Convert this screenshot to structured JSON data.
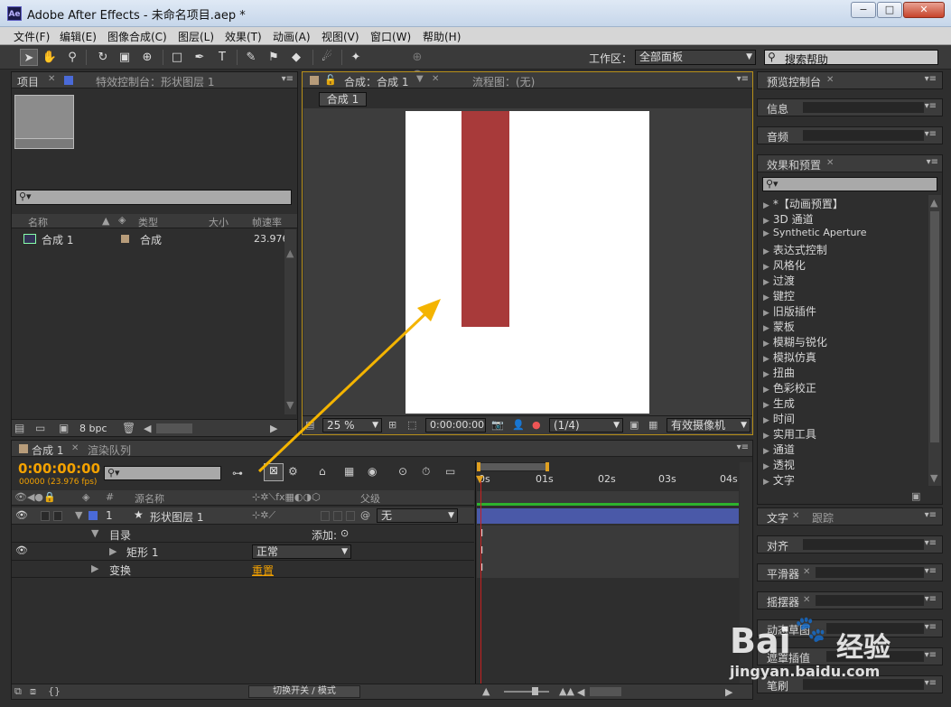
{
  "window": {
    "app_icon": "Ae",
    "title": "Adobe After Effects - 未命名项目.aep *",
    "minimize": "−",
    "maximize": "□",
    "close": "✕"
  },
  "menu": [
    "文件(F)",
    "编辑(E)",
    "图像合成(C)",
    "图层(L)",
    "效果(T)",
    "动画(A)",
    "视图(V)",
    "窗口(W)",
    "帮助(H)"
  ],
  "toolbar": {
    "workspace_label": "工作区：",
    "workspace_value": "全部面板",
    "help_search_placeholder": "搜索帮助"
  },
  "project_panel": {
    "tab": "项目",
    "effects_tab": "特效控制台：形状图层 1",
    "columns": {
      "name": "名称",
      "type": "类型",
      "size": "大小",
      "fps": "帧速率"
    },
    "items": [
      {
        "name": "合成 1",
        "type": "合成",
        "fps": "23.976"
      }
    ],
    "bpc": "8 bpc"
  },
  "comp_panel": {
    "tab": "合成：合成 1",
    "flowchart_tab": "流程图：(无)",
    "subtab": "合成 1",
    "zoom": "25 %",
    "timecode": "0:00:00:00",
    "resolution": "(1/4)",
    "camera": "有效摄像机",
    "layer_color": "#a83a3a"
  },
  "right_panel": {
    "preview": "预览控制台",
    "info": "信息",
    "audio": "音频",
    "effects_presets": "效果和预置",
    "effects_list": [
      "*【动画预置】",
      "3D 通道",
      "Synthetic Aperture",
      "表达式控制",
      "风格化",
      "过渡",
      "键控",
      "旧版插件",
      "蒙板",
      "模糊与锐化",
      "模拟仿真",
      "扭曲",
      "色彩校正",
      "生成",
      "时间",
      "实用工具",
      "通道",
      "透视",
      "文字"
    ],
    "text_tab": "文字",
    "track_tab": "跟踪",
    "align": "对齐",
    "smoother": "平滑器",
    "wiggler": "摇摆器",
    "motion_sketch": "动态草图",
    "mask_interp": "遮罩插值",
    "brushes": "笔刷"
  },
  "timeline": {
    "comp_tab": "合成 1",
    "render_tab": "渲染队列",
    "current_time": "0:00:00:00",
    "fps_info": "00000 (23.976 fps)",
    "col_source": "源名称",
    "col_parent": "父级",
    "layer": {
      "num": "1",
      "name": "形状图层 1",
      "parent": "无"
    },
    "contents_label": "目录",
    "add_label": "添加:",
    "rect_label": "矩形 1",
    "mode": "正常",
    "transform_label": "变换",
    "reset_label": "重置",
    "ruler": [
      "0s",
      "01s",
      "02s",
      "03s",
      "04s"
    ],
    "footer": "切换开关 / 模式"
  },
  "watermark": {
    "brand": "Bai",
    "brand2": "经验",
    "url": "jingyan.baidu.com"
  }
}
